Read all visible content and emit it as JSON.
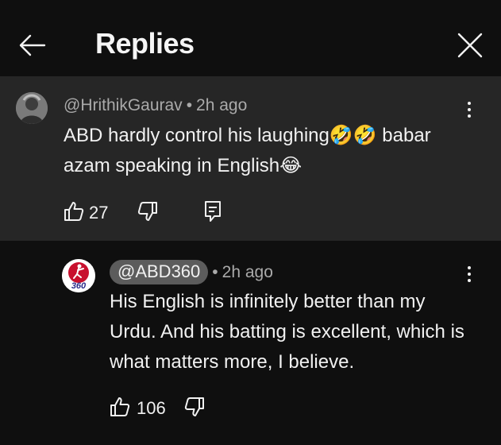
{
  "header": {
    "title": "Replies",
    "back_icon": "arrow-left-icon",
    "close_icon": "close-icon"
  },
  "parent_comment": {
    "author": "@HrithikGaurav",
    "separator": "•",
    "time": "2h ago",
    "text_part1": "ABD hardly control his laughing",
    "emoji_laugh": "🤣🤣",
    "text_part2": " babar azam speaking in English",
    "emoji_grin": "😂",
    "likes": "27"
  },
  "reply": {
    "author": "@ABD360",
    "separator": "•",
    "time": "2h ago",
    "avatar_text": "360",
    "text": "His English is infinitely better than my Urdu. And his batting is excellent, which is what matters more, I believe.",
    "likes": "106"
  },
  "colors": {
    "background": "#0f0f0f",
    "parent_background": "#262626",
    "meta_text": "#aaaaaa",
    "chip": "#5c5c5c",
    "avatar_accent": "#c8102e"
  }
}
